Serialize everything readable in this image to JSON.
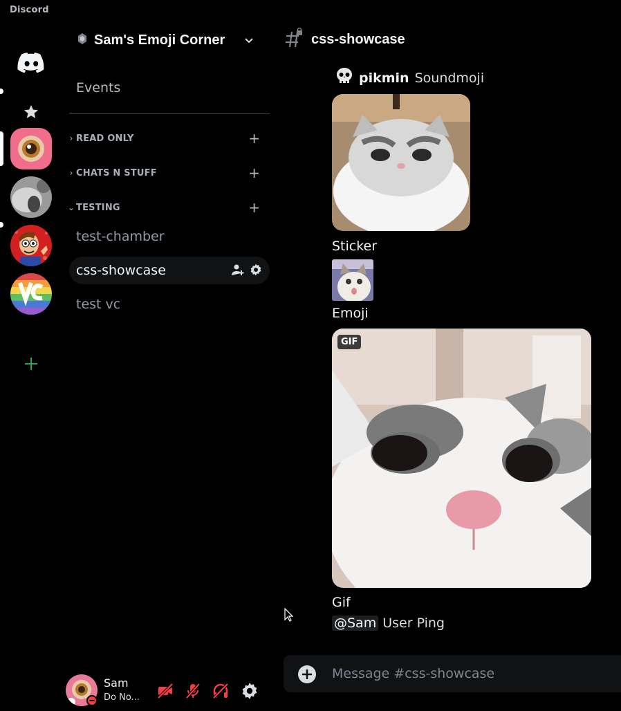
{
  "app": {
    "title": "Discord"
  },
  "rail": {
    "home_icon": "discord-logo-icon",
    "favorites_icon": "star-icon",
    "add_server_icon": "plus-icon",
    "accent_add": "#23a55a"
  },
  "server": {
    "name": "Sam's Emoji Corner",
    "events_label": "Events",
    "categories": [
      {
        "label": "READ ONLY",
        "expanded": false
      },
      {
        "label": "CHATS N STUFF",
        "expanded": false
      },
      {
        "label": "TESTING",
        "expanded": true
      }
    ],
    "channels": [
      {
        "label": "test-chamber",
        "active": false
      },
      {
        "label": "css-showcase",
        "active": true
      },
      {
        "label": "test vc",
        "active": false
      }
    ]
  },
  "user": {
    "name": "Sam",
    "status": "Do No...",
    "status_color": "#f23f43"
  },
  "chat": {
    "channel_name": "css-showcase",
    "soundmoji": {
      "name": "pikmin",
      "type": "Soundmoji",
      "icon": "skull-icon"
    },
    "labels": {
      "sticker": "Sticker",
      "emoji": "Emoji",
      "gif": "Gif",
      "gif_badge": "GIF"
    },
    "ping": {
      "mention": "@Sam",
      "text": "User Ping"
    },
    "composer_placeholder": "Message #css-showcase"
  },
  "colors": {
    "background": "#000000",
    "muted_red": "#f23f43"
  }
}
